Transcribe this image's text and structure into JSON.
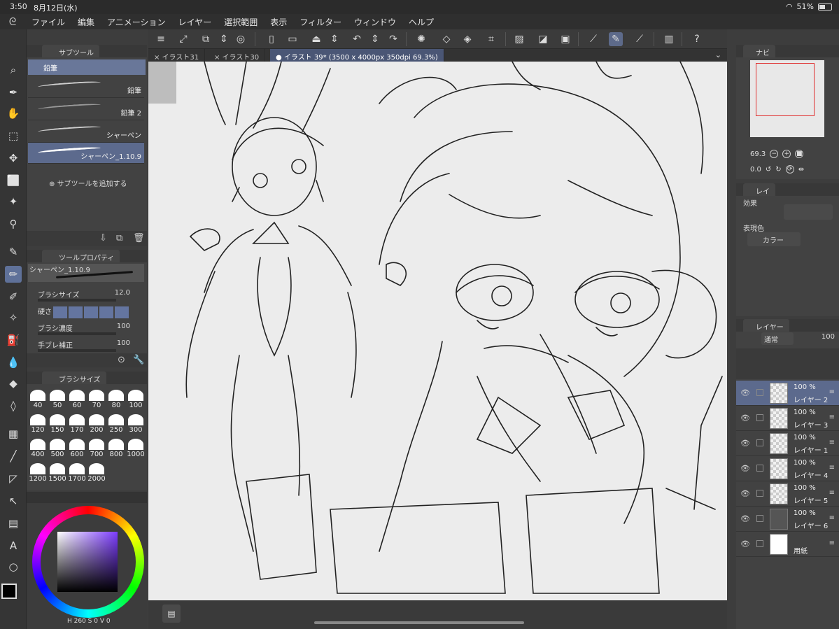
{
  "status_bar": {
    "time": "3:50",
    "date": "8月12日(水)",
    "battery": "51%"
  },
  "menu": {
    "items": [
      "ファイル",
      "編集",
      "アニメーション",
      "レイヤー",
      "選択範囲",
      "表示",
      "フィルター",
      "ウィンドウ",
      "ヘルプ"
    ]
  },
  "subtool": {
    "panel_title": "サブツール",
    "group": "鉛筆",
    "brushes": [
      "鉛筆",
      "鉛筆 2",
      "シャーペン",
      "シャーペン_1.10.9"
    ],
    "selected_index": 3,
    "add_label": "サブツールを追加する"
  },
  "tool_property": {
    "panel_title": "ツールプロパティ",
    "preset_name": "シャーペン_1.10.9",
    "rows": [
      {
        "label": "ブラシサイズ",
        "value": "12.0"
      },
      {
        "label": "硬さ",
        "value": ""
      },
      {
        "label": "ブラシ濃度",
        "value": "100"
      },
      {
        "label": "手ブレ補正",
        "value": "100"
      }
    ]
  },
  "brush_size": {
    "panel_title": "ブラシサイズ",
    "sizes": [
      "40",
      "50",
      "60",
      "70",
      "80",
      "100",
      "120",
      "150",
      "170",
      "200",
      "250",
      "300",
      "400",
      "500",
      "600",
      "700",
      "800",
      "1000",
      "1200",
      "1500",
      "1700",
      "2000"
    ]
  },
  "color": {
    "hsv_readout": "H 260 S 0 V 0",
    "main": "#000000",
    "sub": "#ffffff",
    "square_hue": "#7d3cff"
  },
  "canvas_tabs": [
    {
      "label": "× イラスト31",
      "active": false
    },
    {
      "label": "× イラスト30",
      "active": false
    },
    {
      "label": "● イラスト 39* (3500 x 4000px 350dpi 69.3%)",
      "active": true
    }
  ],
  "navigator": {
    "tab": "ナビ",
    "zoom": "69.3",
    "rotation": "0.0"
  },
  "layer_property": {
    "tab": "レイ",
    "effect_label": "効果",
    "expression_label": "表現色",
    "expression_value": "カラー"
  },
  "layers": {
    "tab": "レイヤー",
    "blend_mode": "通常",
    "opacity": "100",
    "items": [
      {
        "pct": "100 %",
        "mode": "通",
        "name": "レイヤー 2",
        "selected": true
      },
      {
        "pct": "100 %",
        "mode": "通",
        "name": "レイヤー 3",
        "selected": false
      },
      {
        "pct": "100 %",
        "mode": "通",
        "name": "レイヤー 1",
        "selected": false
      },
      {
        "pct": "100 %",
        "mode": "通",
        "name": "レイヤー 4",
        "selected": false
      },
      {
        "pct": "100 %",
        "mode": "通",
        "name": "レイヤー 5",
        "selected": false
      },
      {
        "pct": "100 %",
        "mode": "通",
        "name": "レイヤー 6",
        "selected": false
      },
      {
        "pct": "",
        "mode": "",
        "name": "用紙",
        "selected": false
      }
    ]
  }
}
